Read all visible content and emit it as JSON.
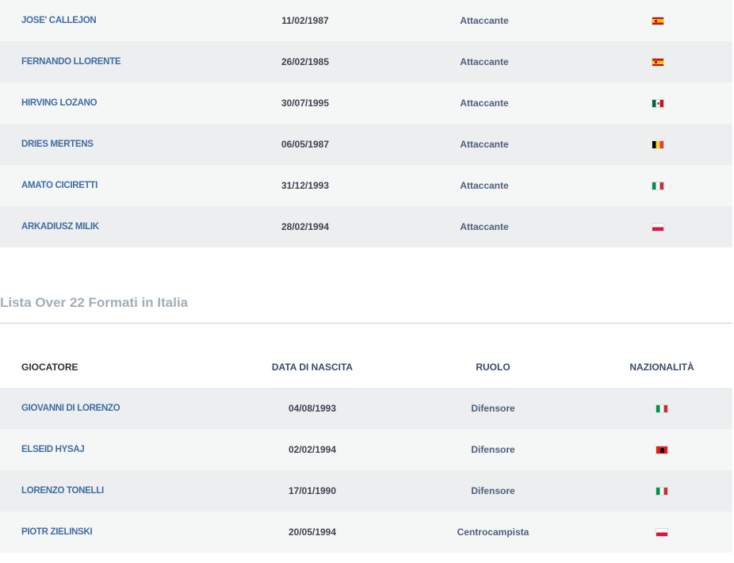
{
  "table1": {
    "rows": [
      {
        "name": "JOSE' CALLEJON",
        "date": "11/02/1987",
        "role": "Attaccante",
        "flag": "es"
      },
      {
        "name": "FERNANDO LLORENTE",
        "date": "26/02/1985",
        "role": "Attaccante",
        "flag": "es"
      },
      {
        "name": "HIRVING LOZANO",
        "date": "30/07/1995",
        "role": "Attaccante",
        "flag": "mx"
      },
      {
        "name": "DRIES MERTENS",
        "date": "06/05/1987",
        "role": "Attaccante",
        "flag": "be"
      },
      {
        "name": "AMATO CICIRETTI",
        "date": "31/12/1993",
        "role": "Attaccante",
        "flag": "it"
      },
      {
        "name": "ARKADIUSZ MILIK",
        "date": "28/02/1994",
        "role": "Attaccante",
        "flag": "pl"
      }
    ]
  },
  "section": {
    "title": "Lista Over 22 Formati in Italia"
  },
  "table2": {
    "headers": {
      "player": "GIOCATORE",
      "birth": "DATA DI NASCITA",
      "role": "RUOLO",
      "nationality": "NAZIONALITÀ"
    },
    "rows": [
      {
        "name": "GIOVANNI DI LORENZO",
        "date": "04/08/1993",
        "role": "Difensore",
        "flag": "it"
      },
      {
        "name": "ELSEID HYSAJ",
        "date": "02/02/1994",
        "role": "Difensore",
        "flag": "al"
      },
      {
        "name": "LORENZO TONELLI",
        "date": "17/01/1990",
        "role": "Difensore",
        "flag": "it"
      },
      {
        "name": "PIOTR ZIELINSKI",
        "date": "20/05/1994",
        "role": "Centrocampista",
        "flag": "pl"
      }
    ]
  },
  "flag_icons": {
    "es": "spain-flag-icon",
    "mx": "mexico-flag-icon",
    "be": "belgium-flag-icon",
    "it": "italy-flag-icon",
    "pl": "poland-flag-icon",
    "al": "albania-flag-icon"
  }
}
